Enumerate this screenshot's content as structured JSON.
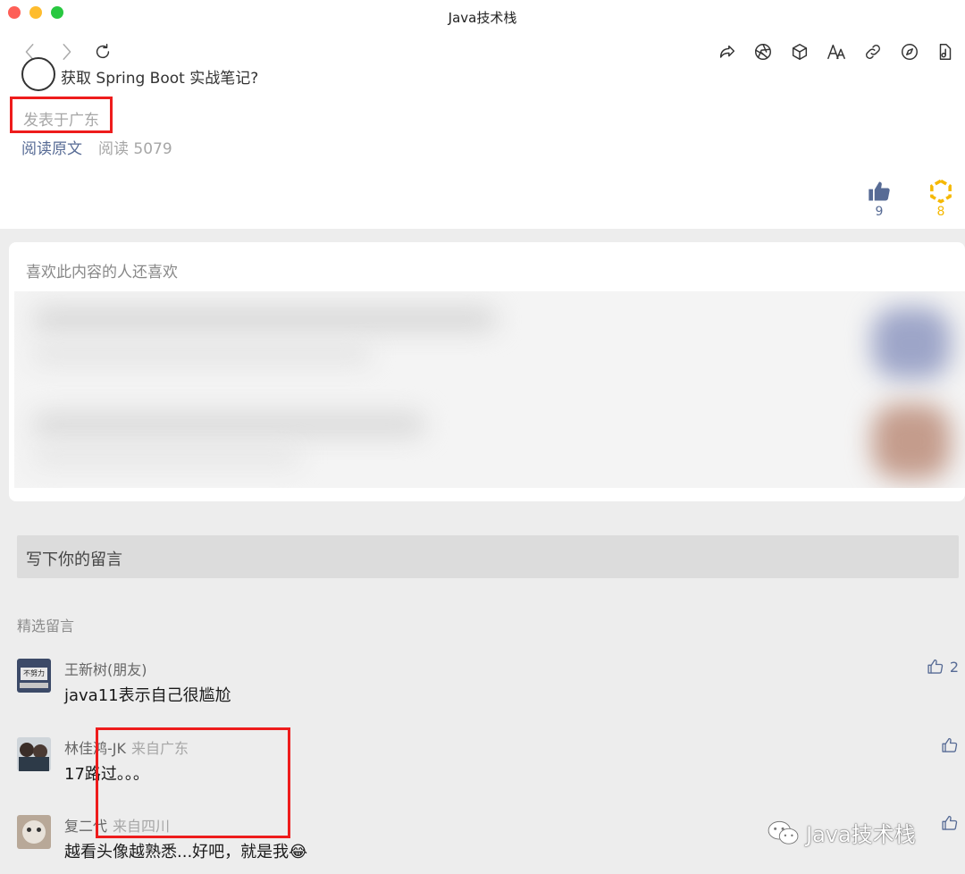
{
  "window": {
    "title": "Java技术栈"
  },
  "toolbar": {
    "icons": [
      "back-icon",
      "forward-icon",
      "refresh-icon",
      "share-icon",
      "aperture-icon",
      "cube-icon",
      "font-size-icon",
      "link-icon",
      "compass-icon",
      "note-icon"
    ]
  },
  "article": {
    "partial_line": "获取 Spring Boot 实战笔记?",
    "location": "发表于广东",
    "read_original": "阅读原文",
    "read_count": "阅读 5079",
    "like_count": "9",
    "wow_count": "8"
  },
  "recommend": {
    "title": "喜欢此内容的人还喜欢"
  },
  "comment_box": {
    "placeholder": "写下你的留言"
  },
  "comments": {
    "section_title": "精选留言",
    "items": [
      {
        "name": "王新树(朋友)",
        "location": "",
        "text": "java11表示自己很尴尬",
        "likes": "2",
        "avatar_text": "不努力"
      },
      {
        "name": "林佳鸿-JK",
        "location": "来自广东",
        "text": "17路过。。。",
        "likes": "",
        "avatar_text": ""
      },
      {
        "name": "复二代",
        "location": "来自四川",
        "text": "越看头像越熟悉...好吧，就是我😂",
        "likes": "",
        "avatar_text": ""
      }
    ]
  },
  "watermark": {
    "text": "Java技术栈"
  },
  "colors": {
    "link": "#576b95",
    "highlight": "#ee1c1c",
    "wow": "#f5b800"
  }
}
